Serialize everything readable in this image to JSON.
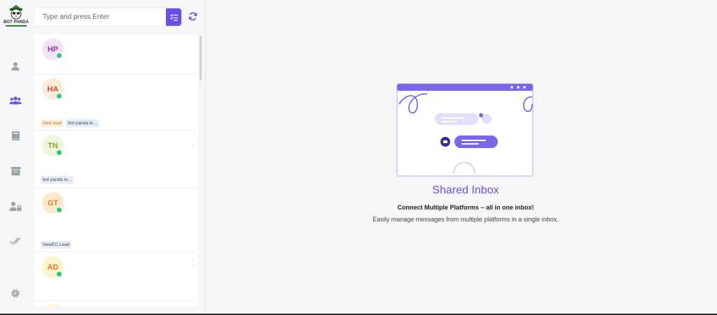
{
  "brand": {
    "name": "BOT PANDA"
  },
  "colors": {
    "accent": "#6c4dea",
    "online": "#2ecc71"
  },
  "nav": {
    "items": [
      {
        "name": "user-icon",
        "active": false
      },
      {
        "name": "team-icon",
        "active": true
      },
      {
        "name": "book-icon",
        "active": false
      },
      {
        "name": "archive-icon",
        "active": false
      },
      {
        "name": "user-lock-icon",
        "active": false
      },
      {
        "name": "double-check-icon",
        "active": false
      },
      {
        "name": "gear-icon",
        "active": false
      }
    ]
  },
  "search": {
    "placeholder": "Type and press Enter",
    "filter_icon": "filter-list-icon",
    "refresh_icon": "refresh-icon"
  },
  "conversations": [
    {
      "initials": "HP",
      "avatar_bg": "#f1e4f6",
      "avatar_color": "#8e3aa8",
      "online": true,
      "tags": []
    },
    {
      "initials": "HA",
      "avatar_bg": "#fdebdc",
      "avatar_color": "#d8452f",
      "online": true,
      "tags": [
        {
          "label": "New lead",
          "style": "orange"
        },
        {
          "label": "bot panda le...",
          "style": "blue"
        }
      ]
    },
    {
      "initials": "TN",
      "avatar_bg": "#eef6dc",
      "avatar_color": "#7aa82e",
      "online": true,
      "tags": [
        {
          "label": "bot panda le...",
          "style": "blue"
        }
      ]
    },
    {
      "initials": "GT",
      "avatar_bg": "#fdeacc",
      "avatar_color": "#d8842a",
      "online": true,
      "tags": [
        {
          "label": "NewEC Lead",
          "style": "blue"
        }
      ]
    },
    {
      "initials": "AD",
      "avatar_bg": "#fff4cc",
      "avatar_color": "#e57a1f",
      "online": true,
      "tags": []
    }
  ],
  "empty_state": {
    "title": "Shared Inbox",
    "subtitle": "Connect Multiple Platforms – all in one inbox!",
    "description": "Easily manage messages from multiple platforms in a single inbox."
  }
}
